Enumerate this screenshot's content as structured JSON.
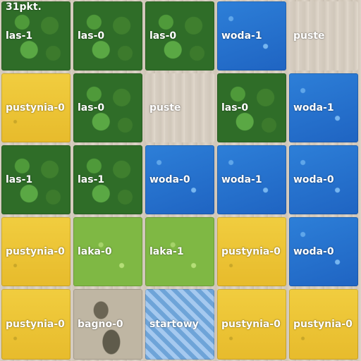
{
  "score": "31pkt.",
  "grid": [
    [
      "las-1",
      "las-0",
      "las-0",
      "woda-1",
      "puste"
    ],
    [
      "pustynia-0",
      "las-0",
      "puste",
      "las-0",
      "woda-1"
    ],
    [
      "las-1",
      "las-1",
      "woda-0",
      "woda-1",
      "woda-0"
    ],
    [
      "pustynia-0",
      "laka-0",
      "laka-1",
      "pustynia-0",
      "woda-0"
    ],
    [
      "pustynia-0",
      "bagno-0",
      "startowy",
      "pustynia-0",
      "pustynia-0"
    ]
  ],
  "colors": {
    "las": "#2f6d28",
    "woda": "#1f64c2",
    "pustynia": "#e7bb2c",
    "laka": "#7fb844",
    "bagno": "#bfb6a3",
    "startowy": "#6ea4d8",
    "puste": "#d9d0c4"
  }
}
